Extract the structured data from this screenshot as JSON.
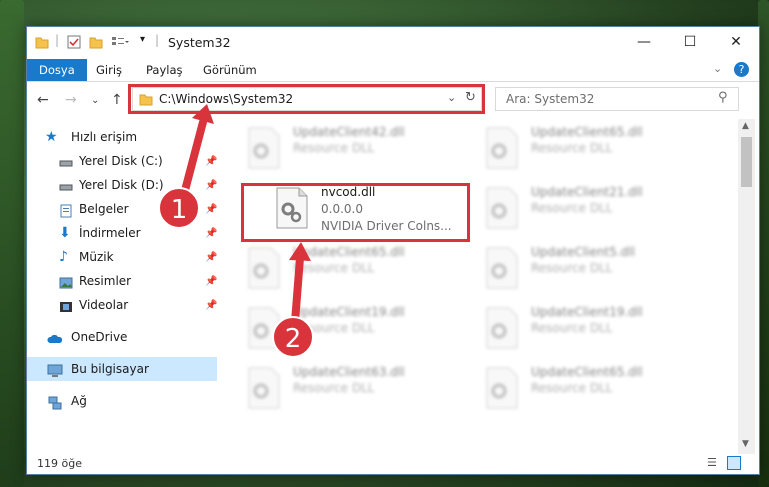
{
  "window": {
    "title": "System32",
    "controls": {
      "minimize": "—",
      "maximize": "☐",
      "close": "✕"
    }
  },
  "ribbon": {
    "tabs": [
      "Dosya",
      "Giriş",
      "Paylaş",
      "Görünüm"
    ],
    "active_tab": "Dosya"
  },
  "address": {
    "path": "C:\\Windows\\System32",
    "search_placeholder": "Ara: System32"
  },
  "nav_pane": {
    "quick_access": "Hızlı erişim",
    "items": [
      {
        "label": "Yerel Disk (C:)",
        "icon": "drive-icon",
        "pinned": true
      },
      {
        "label": "Yerel Disk (D:)",
        "icon": "drive-icon",
        "pinned": true
      },
      {
        "label": "Belgeler",
        "icon": "documents-icon",
        "pinned": true
      },
      {
        "label": "İndirmeler",
        "icon": "download-icon",
        "pinned": true
      },
      {
        "label": "Müzik",
        "icon": "music-icon",
        "pinned": true
      },
      {
        "label": "Resimler",
        "icon": "pictures-icon",
        "pinned": true
      },
      {
        "label": "Videolar",
        "icon": "video-icon",
        "pinned": true
      }
    ],
    "onedrive": "OneDrive",
    "this_pc": "Bu bilgisayar",
    "network": "Ağ"
  },
  "files": {
    "left": [
      {
        "name": "UpdateClient42.dll",
        "sub": "Resource DLL"
      },
      {
        "name": "nvcod.dll",
        "version": "0.0.0.0",
        "sub": "NVIDIA Driver Colns..."
      },
      {
        "name": "UpdateClient65.dll",
        "sub": "Resource DLL"
      },
      {
        "name": "UpdateClient19.dll",
        "sub": "Resource DLL"
      },
      {
        "name": "UpdateClient63.dll",
        "sub": "Resource DLL"
      }
    ],
    "right": [
      {
        "name": "UpdateClient65.dll",
        "sub": "Resource DLL"
      },
      {
        "name": "UpdateClient21.dll",
        "sub": "Resource DLL"
      },
      {
        "name": "UpdateClient5.dll",
        "sub": "Resource DLL"
      },
      {
        "name": "UpdateClient19.dll",
        "sub": "Resource DLL"
      },
      {
        "name": "UpdateClient65.dll",
        "sub": "Resource DLL"
      }
    ]
  },
  "status": {
    "item_count": "119 öğe"
  },
  "annotations": {
    "step1": "1",
    "step2": "2",
    "highlight_color": "#d9343b"
  },
  "colors": {
    "accent": "#1979ca",
    "selection": "#cce8ff"
  }
}
